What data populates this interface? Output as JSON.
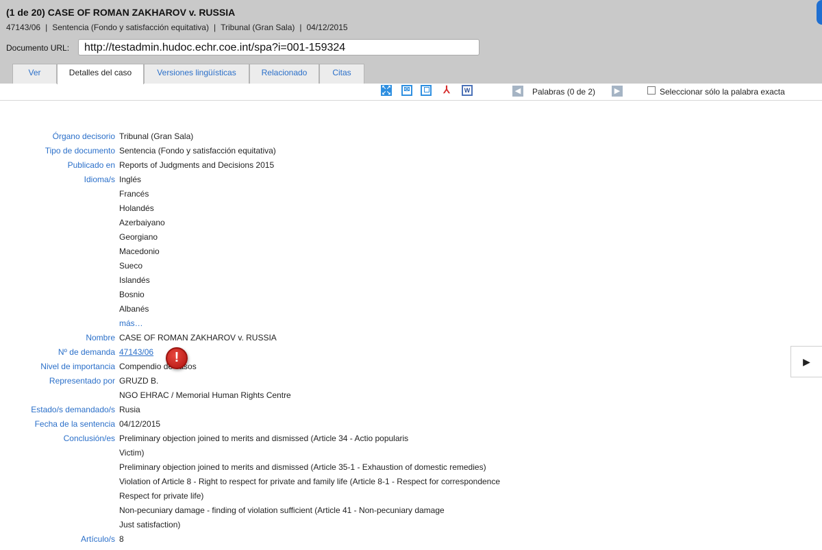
{
  "header": {
    "title": "(1 de 20) CASE OF ROMAN ZAKHAROV v. RUSSIA",
    "meta": [
      "47143/06",
      "Sentencia (Fondo y satisfacción equitativa)",
      "Tribunal (Gran Sala)",
      "04/12/2015"
    ],
    "meta_separator": "|",
    "url_label": "Documento URL:",
    "url_value": "http://testadmin.hudoc.echr.coe.int/spa?i=001-159324"
  },
  "tabs": [
    "Ver",
    "Detalles del caso",
    "Versiones lingüísticas",
    "Relacionado",
    "Citas"
  ],
  "active_tab": "Detalles del caso",
  "toolbar": {
    "icons": [
      "expand-icon",
      "email-icon",
      "print-icon",
      "pdf-icon",
      "word-icon"
    ],
    "prev_arrow": "◀",
    "next_arrow": "▶",
    "words_label": "Palabras (0 de 2)",
    "exact_word_label": "Seleccionar sólo la palabra exacta",
    "exact_word_checked": false
  },
  "details": {
    "rows": [
      {
        "label": "Órgano decisorio",
        "value": "Tribunal (Gran Sala)"
      },
      {
        "label": "Tipo de documento",
        "value": "Sentencia (Fondo y satisfacción equitativa)"
      },
      {
        "label": "Publicado en",
        "value": "Reports of Judgments and Decisions 2015"
      },
      {
        "label": "Idioma/s",
        "value": "Inglés"
      },
      {
        "label": "",
        "value": "Francés"
      },
      {
        "label": "",
        "value": "Holandés"
      },
      {
        "label": "",
        "value": "Azerbaiyano"
      },
      {
        "label": "",
        "value": "Georgiano"
      },
      {
        "label": "",
        "value": "Macedonio"
      },
      {
        "label": "",
        "value": "Sueco"
      },
      {
        "label": "",
        "value": "Islandés"
      },
      {
        "label": "",
        "value": "Bosnio"
      },
      {
        "label": "",
        "value": "Albanés"
      },
      {
        "label": "",
        "value": "más…"
      },
      {
        "label": "Nombre",
        "value": "CASE OF ROMAN ZAKHAROV v. RUSSIA"
      },
      {
        "label": "Nº de demanda",
        "value": "47143/06"
      },
      {
        "label": "Nivel de importancia",
        "value": "Compendio de casos"
      },
      {
        "label": "Representado por",
        "value": "GRUZD B."
      },
      {
        "label": "",
        "value": "NGO EHRAC / Memorial Human Rights Centre"
      },
      {
        "label": "Estado/s demandado/s",
        "value": "Rusia"
      },
      {
        "label": "Fecha de la sentencia",
        "value": "04/12/2015"
      },
      {
        "label": "Conclusión/es",
        "value": "Preliminary objection joined to merits and dismissed (Article 34 - Actio popularis"
      },
      {
        "label": "",
        "value": "Victim)"
      },
      {
        "label": "",
        "value": "Preliminary objection joined to merits and dismissed (Article 35-1 - Exhaustion of domestic remedies)"
      },
      {
        "label": "",
        "value": "Violation of Article 8 - Right to respect for private and family life (Article 8-1 - Respect for correspondence"
      },
      {
        "label": "",
        "value": "Respect for private life)"
      },
      {
        "label": "",
        "value": "Non-pecuniary damage - finding of violation sufficient (Article 41 - Non-pecuniary damage"
      },
      {
        "label": "",
        "value": "Just satisfaction)"
      },
      {
        "label": "Artículo/s",
        "value": "8"
      }
    ]
  },
  "overlay": {
    "alert_badge": "!",
    "side_next_arrow": "▶"
  },
  "colors": {
    "header_bg": "#c9c9c9",
    "link": "#2a6fc9",
    "alert": "#c81e17"
  }
}
